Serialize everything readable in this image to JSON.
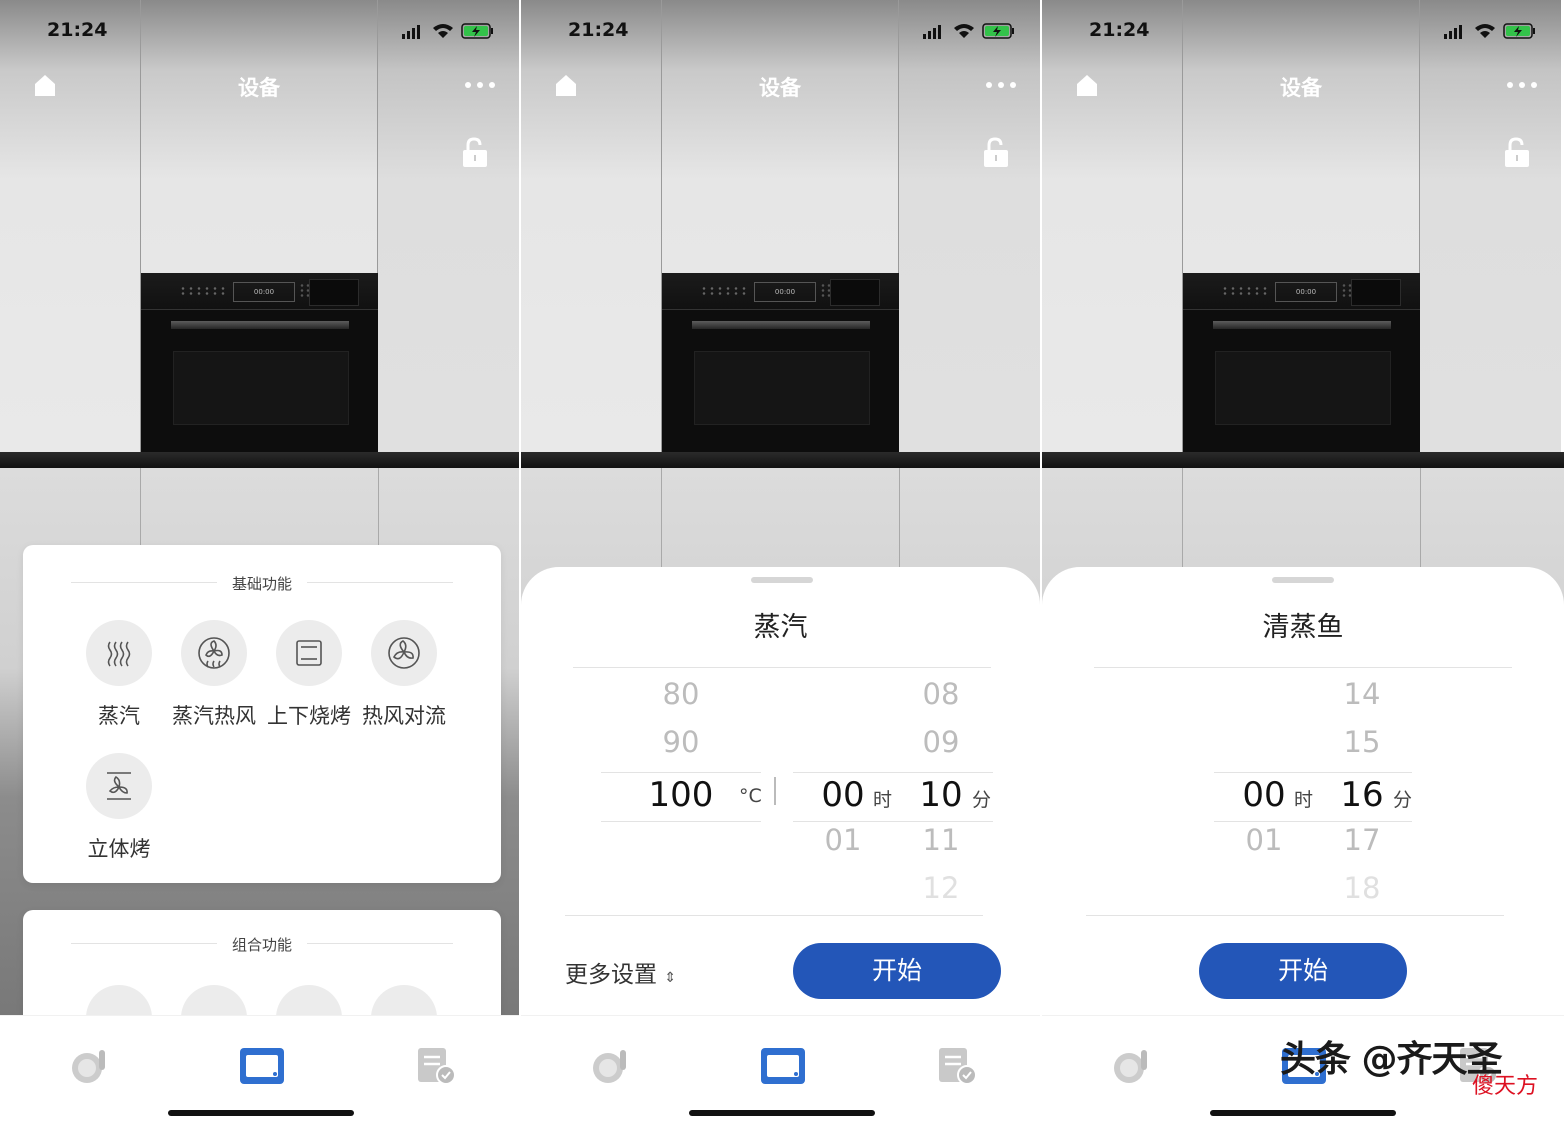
{
  "status_bar": {
    "time": "21:24"
  },
  "header": {
    "title": "设备"
  },
  "oven_display": "00:00",
  "phone1": {
    "basic_section": "基础功能",
    "combo_section": "组合功能",
    "functions": [
      {
        "label": "蒸汽",
        "icon": "steam-icon"
      },
      {
        "label": "蒸汽热风",
        "icon": "steam-fan-icon"
      },
      {
        "label": "上下烧烤",
        "icon": "top-bottom-grill-icon"
      },
      {
        "label": "热风对流",
        "icon": "fan-convection-icon"
      },
      {
        "label": "立体烤",
        "icon": "3d-bake-icon"
      }
    ]
  },
  "phone2": {
    "title": "蒸汽",
    "temp": {
      "above": [
        "80",
        "90"
      ],
      "selected": "100",
      "unit": "°C"
    },
    "hours": {
      "selected": "00",
      "below": "01",
      "unit": "时"
    },
    "minutes": {
      "above": [
        "08",
        "09"
      ],
      "selected": "10",
      "below": [
        "11",
        "12"
      ],
      "unit": "分"
    },
    "more_settings": "更多设置",
    "start": "开始"
  },
  "phone3": {
    "title": "清蒸鱼",
    "hours": {
      "selected": "00",
      "below": "01",
      "unit": "时"
    },
    "minutes": {
      "above": [
        "14",
        "15"
      ],
      "selected": "16",
      "below": [
        "17",
        "18"
      ],
      "unit": "分"
    },
    "start": "开始"
  },
  "watermark": {
    "text": "头条 @齐天圣",
    "sub": "傻天方"
  },
  "colors": {
    "accent": "#2356b8"
  }
}
